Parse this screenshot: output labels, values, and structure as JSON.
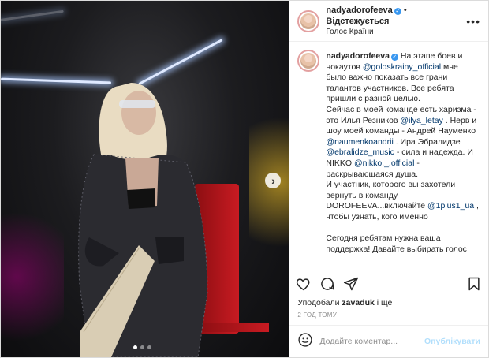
{
  "header": {
    "username": "nadyadorofeeva",
    "separator": "•",
    "follow_label": "Відстежується",
    "location": "Голос Країни",
    "more_icon": "more-horizontal-icon"
  },
  "caption": {
    "username": "nadyadorofeeva",
    "lines": [
      {
        "t": "text",
        "v": "На этапе боев и нокаутов "
      },
      {
        "t": "mention",
        "v": "@goloskrainy_official"
      },
      {
        "t": "text",
        "v": " мне было важно показать все грани талантов участников. Все ребята пришли с разной целью.\nСейчас в моей команде есть харизма - это Илья Резников "
      },
      {
        "t": "mention",
        "v": "@ilya_letay"
      },
      {
        "t": "text",
        "v": " . Нерв и шоу моей команды - Андрей Науменко "
      },
      {
        "t": "mention",
        "v": "@naumenkoandrii"
      },
      {
        "t": "text",
        "v": " . Ира Эбралидзе "
      },
      {
        "t": "mention",
        "v": "@ebralidze_music"
      },
      {
        "t": "text",
        "v": " - сила и надежда. И NIKKO "
      },
      {
        "t": "mention",
        "v": "@nikko._.official"
      },
      {
        "t": "text",
        "v": " - раскрывающаяся душа.\nИ участник, которого вы захотели вернуть в команду DOROFEEVA...включайте "
      },
      {
        "t": "mention",
        "v": "@1plus1_ua"
      },
      {
        "t": "text",
        "v": " , чтобы узнать, кого именно\n\nСегодня ребятам нужна ваша поддержка! Давайте выбирать голос"
      }
    ]
  },
  "actions": {
    "like_icon": "heart-icon",
    "comment_icon": "comment-icon",
    "share_icon": "share-icon",
    "save_icon": "bookmark-icon"
  },
  "likes": {
    "prefix": "Уподобали ",
    "user": "zavaduk",
    "suffix": " і ще"
  },
  "timestamp": "2 ГОД ТОМУ",
  "comment": {
    "emoji_icon": "emoji-icon",
    "placeholder": "Додайте коментар...",
    "publish_label": "Опублікувати"
  },
  "media": {
    "next_icon": "chevron-right-icon",
    "next_glyph": "›",
    "slide_count": 3,
    "active_slide": 1
  },
  "colors": {
    "link": "#00376b",
    "publish_disabled": "#b2dffc",
    "verified": "#3897f0",
    "meta": "#8e8e8e"
  }
}
